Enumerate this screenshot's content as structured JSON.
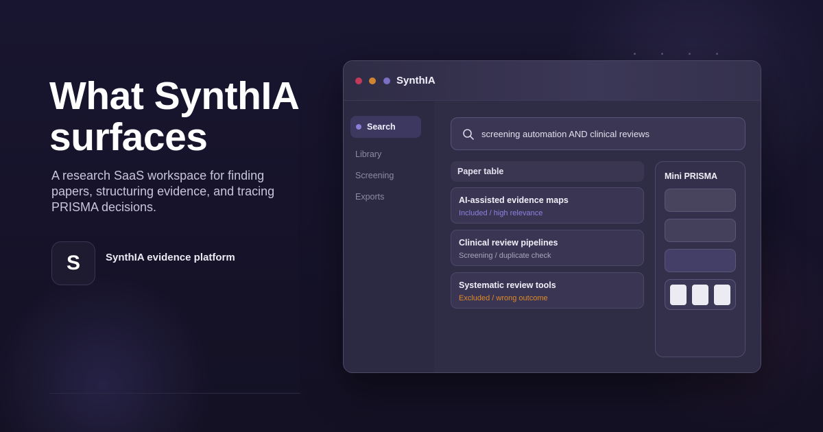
{
  "hero": {
    "title": "What SynthIA surfaces",
    "subtitle": "A research SaaS workspace for finding papers, structuring evidence, and tracing PRISMA decisions.",
    "brand_initial": "S",
    "brand_name": "SynthIA evidence platform"
  },
  "window": {
    "app_name": "SynthIA",
    "controls": [
      "close-dot",
      "minimize-dot",
      "maximize-dot"
    ]
  },
  "sidebar": {
    "items": [
      {
        "label": "Search",
        "active": true
      },
      {
        "label": "Library",
        "active": false
      },
      {
        "label": "Screening",
        "active": false
      },
      {
        "label": "Exports",
        "active": false
      }
    ]
  },
  "search": {
    "query": "screening automation AND clinical reviews",
    "icon": "search-icon"
  },
  "paper_table": {
    "header": "Paper table",
    "rows": [
      {
        "title": "AI-assisted evidence maps",
        "status": "Included / high relevance",
        "status_color": "#8d82e0"
      },
      {
        "title": "Clinical review pipelines",
        "status": "Screening / duplicate check",
        "status_color": "#a9a5bc"
      },
      {
        "title": "Systematic review tools",
        "status": "Excluded / wrong outcome",
        "status_color": "#e08a2a"
      }
    ]
  },
  "mini_prisma": {
    "title": "Mini PRISMA",
    "final_tiles": 3
  },
  "colors": {
    "background": "#161327",
    "window": "#2a2740",
    "accent": "#8a7fd6",
    "excluded": "#e08a2a",
    "close": "#c23a5a",
    "minimize": "#d08430",
    "maximize": "#7b6fc4"
  }
}
